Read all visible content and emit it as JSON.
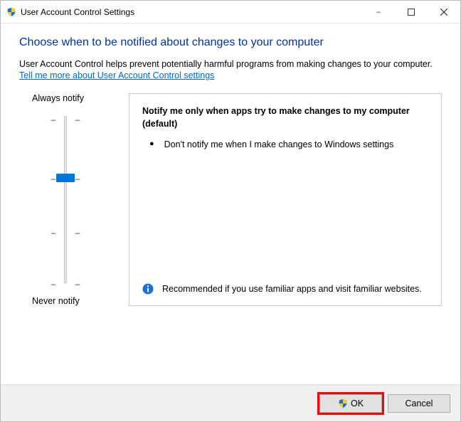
{
  "titlebar": {
    "title": "User Account Control Settings"
  },
  "heading": "Choose when to be notified about changes to your computer",
  "description": "User Account Control helps prevent potentially harmful programs from making changes to your computer.",
  "help_link": "Tell me more about User Account Control settings",
  "slider": {
    "top_label": "Always notify",
    "bottom_label": "Never notify"
  },
  "info": {
    "title": "Notify me only when apps try to make changes to my computer (default)",
    "bullet": "Don't notify me when I make changes to Windows settings",
    "recommendation": "Recommended if you use familiar apps and visit familiar websites."
  },
  "buttons": {
    "ok": "OK",
    "cancel": "Cancel"
  }
}
